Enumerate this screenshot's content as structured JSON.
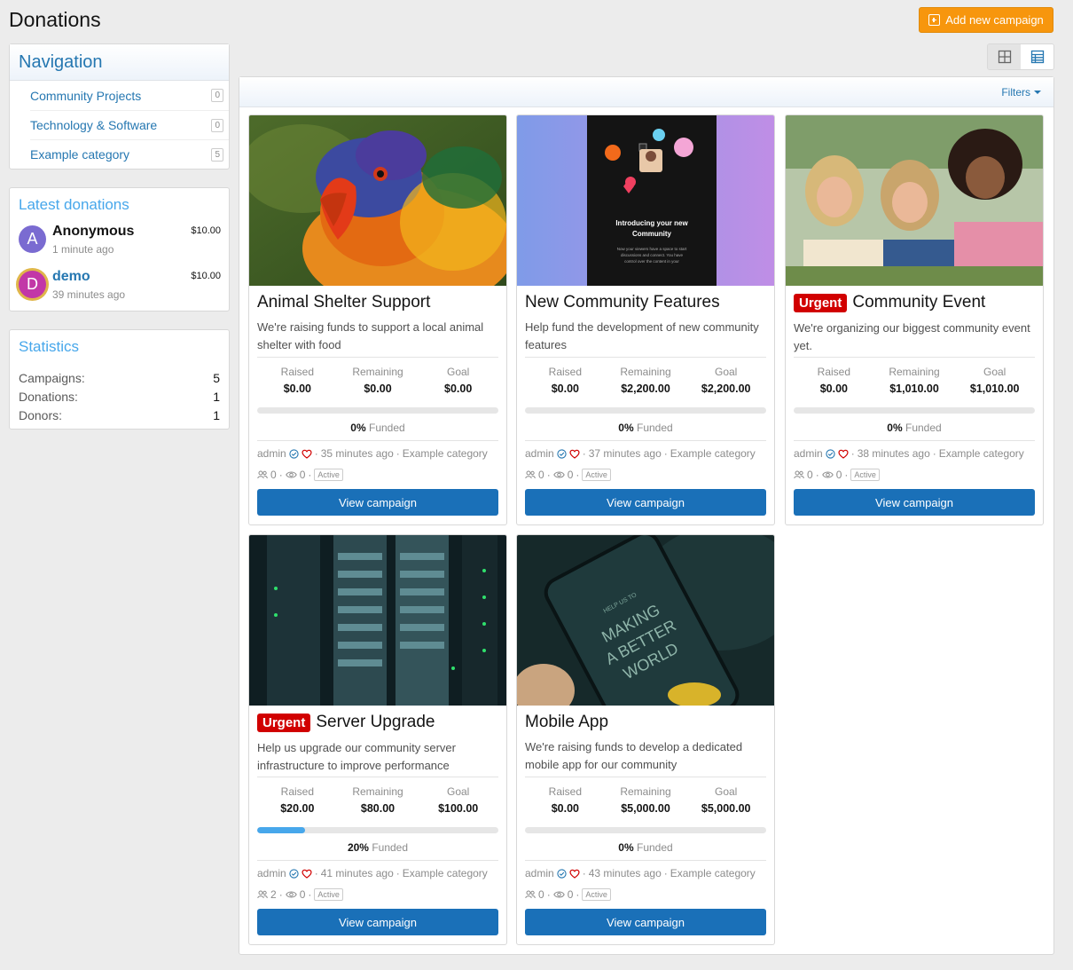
{
  "page": {
    "title": "Donations",
    "add_label": "Add new campaign"
  },
  "nav": {
    "title": "Navigation",
    "items": [
      {
        "label": "Community Projects",
        "count": "0"
      },
      {
        "label": "Technology & Software",
        "count": "0"
      },
      {
        "label": "Example category",
        "count": "5"
      }
    ]
  },
  "latest": {
    "title": "Latest donations",
    "items": [
      {
        "initial": "A",
        "name": "Anonymous",
        "time": "1 minute ago",
        "amount": "$10.00",
        "color": "#7a6bd1"
      },
      {
        "initial": "D",
        "name": "demo",
        "time": "39 minutes ago",
        "amount": "$10.00",
        "color": "#c237a7"
      }
    ]
  },
  "stats": {
    "title": "Statistics",
    "rows": [
      {
        "label": "Campaigns:",
        "value": "5"
      },
      {
        "label": "Donations:",
        "value": "1"
      },
      {
        "label": "Donors:",
        "value": "1"
      }
    ]
  },
  "filters_label": "Filters",
  "labels": {
    "raised": "Raised",
    "remaining": "Remaining",
    "goal": "Goal",
    "funded": "Funded",
    "view": "View campaign",
    "active": "Active",
    "urgent": "Urgent"
  },
  "campaigns": [
    {
      "title": "Animal Shelter Support",
      "urgent": false,
      "desc": "We're raising funds to support a local animal shelter with food",
      "raised": "$0.00",
      "remaining": "$0.00",
      "goal": "$0.00",
      "pct": 0,
      "pct_label": "0%",
      "author": "admin",
      "time": "35 minutes ago",
      "category": "Example category",
      "donors": "0",
      "views": "0"
    },
    {
      "title": "New Community Features",
      "urgent": false,
      "desc": "Help fund the development of new community features",
      "raised": "$0.00",
      "remaining": "$2,200.00",
      "goal": "$2,200.00",
      "pct": 0,
      "pct_label": "0%",
      "author": "admin",
      "time": "37 minutes ago",
      "category": "Example category",
      "donors": "0",
      "views": "0",
      "promo": {
        "line1": "Introducing your new",
        "line2": "Community",
        "small": "Now your viewers have a space to start discussions and connect. You have control over the content in your Community."
      }
    },
    {
      "title": "Community Event",
      "urgent": true,
      "desc": "We're organizing our biggest community event yet.",
      "raised": "$0.00",
      "remaining": "$1,010.00",
      "goal": "$1,010.00",
      "pct": 0,
      "pct_label": "0%",
      "author": "admin",
      "time": "38 minutes ago",
      "category": "Example category",
      "donors": "0",
      "views": "0"
    },
    {
      "title": "Server Upgrade",
      "urgent": true,
      "desc": "Help us upgrade our community server infrastructure to improve performance",
      "raised": "$20.00",
      "remaining": "$80.00",
      "goal": "$100.00",
      "pct": 20,
      "pct_label": "20%",
      "author": "admin",
      "time": "41 minutes ago",
      "category": "Example category",
      "donors": "2",
      "views": "0"
    },
    {
      "title": "Mobile App",
      "urgent": false,
      "desc": "We're raising funds to develop a dedicated mobile app for our community",
      "raised": "$0.00",
      "remaining": "$5,000.00",
      "goal": "$5,000.00",
      "pct": 0,
      "pct_label": "0%",
      "author": "admin",
      "time": "43 minutes ago",
      "category": "Example category",
      "donors": "0",
      "views": "0",
      "promo": {
        "line1": "MAKING",
        "line2": "A BETTER",
        "line3": "WORLD",
        "small": "HELP US TO"
      }
    }
  ]
}
